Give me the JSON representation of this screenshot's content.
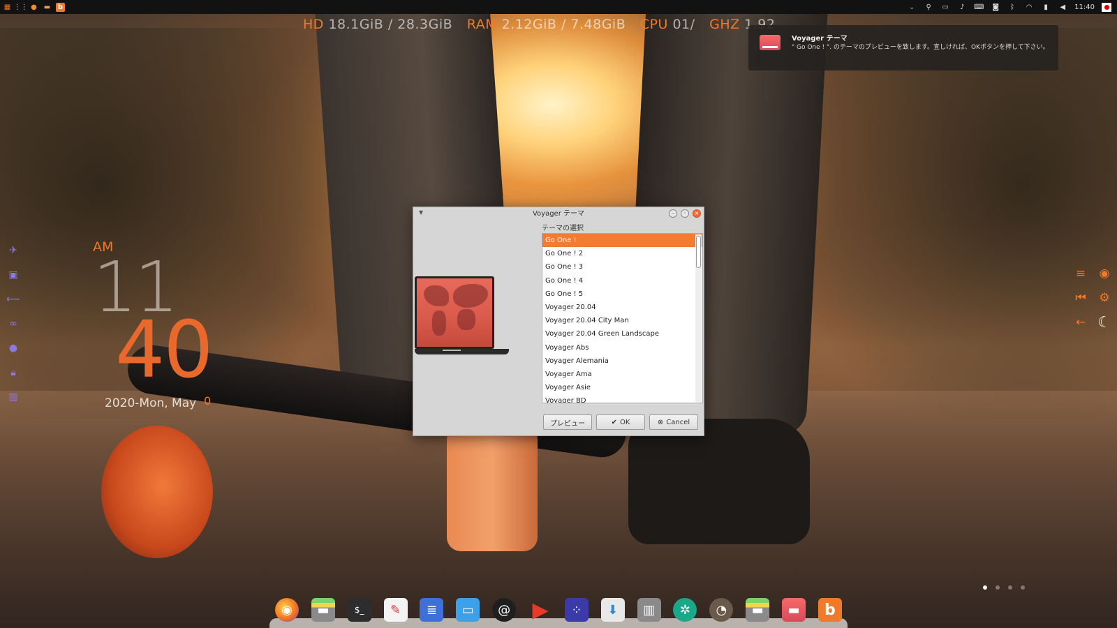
{
  "system_monitor": {
    "hd_label": "HD",
    "hd_value": "18.1GiB / 28.3GiB",
    "ram_label": "RAM",
    "ram_value": "2.12GiB / 7.48GiB",
    "cpu_label": "CPU",
    "cpu_value": "01/",
    "ghz_label": "GHZ",
    "ghz_value": "1.92"
  },
  "top_panel": {
    "time": "11:40",
    "left_icons": [
      "app-menu-icon",
      "grid-icon",
      "firefox-icon",
      "files-icon",
      "b-app-icon"
    ],
    "right_icons": [
      "chevron-down-icon",
      "search-icon",
      "window-icon",
      "bell-icon",
      "keyboard-icon",
      "camera-icon",
      "bluetooth-icon",
      "wifi-icon",
      "battery-icon",
      "volume-icon",
      "flag-icon"
    ]
  },
  "notification": {
    "title": "Voyager テーマ",
    "body": "\" Go One ! \". のテーマのプレビューを致します。宜しければ、OKボタンを押して下さい。"
  },
  "clock": {
    "ampm": "AM",
    "hour": "11",
    "minute": "40",
    "date": "2020-Mon, May",
    "day": "0"
  },
  "dialog": {
    "title": "Voyager テーマ",
    "select_label": "テーマの選択",
    "themes": [
      "Go One !",
      "Go One ! 2",
      "Go One ! 3",
      "Go One ! 4",
      "Go One ! 5",
      "Voyager 20.04",
      "Voyager 20.04 City Man",
      "Voyager 20.04 Green Landscape",
      "Voyager Abs",
      "Voyager Alemania",
      "Voyager Ama",
      "Voyager Asie",
      "Voyager BD"
    ],
    "selected_index": 0,
    "preview_button": "プレビュー",
    "ok_button": "OK",
    "cancel_button": "Cancel"
  },
  "dock_icons": [
    "firefox-icon",
    "files-icon",
    "terminal-icon",
    "text-editor-icon",
    "document-icon",
    "desktop-icon",
    "mail-icon",
    "media-player-icon",
    "dots-app-icon",
    "software-installer-icon",
    "trash-icon",
    "aperture-icon",
    "gimp-icon",
    "files2-icon",
    "voyager-theme-icon",
    "b-app-icon"
  ],
  "colors": {
    "accent": "#f37b32",
    "monitor_text": "#ffffff",
    "left_dock": "#8a7ae0"
  }
}
